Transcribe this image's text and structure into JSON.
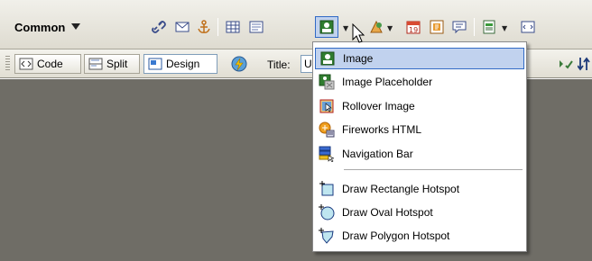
{
  "insert_bar": {
    "category": "Common",
    "tool_icons": [
      "hyperlink-icon",
      "email-link-icon",
      "named-anchor-icon",
      "table-icon",
      "div-icon",
      "image-icon",
      "media-icon",
      "date-icon",
      "server-side-include-icon",
      "comment-icon",
      "templates-icon",
      "tag-chooser-icon"
    ]
  },
  "doc_toolbar": {
    "code_label": "Code",
    "split_label": "Split",
    "design_label": "Design",
    "title_label": "Title:",
    "title_value": "U"
  },
  "image_menu": {
    "items": [
      {
        "label": "Image",
        "icon": "image-icon"
      },
      {
        "label": "Image Placeholder",
        "icon": "image-placeholder-icon"
      },
      {
        "label": "Rollover Image",
        "icon": "rollover-image-icon"
      },
      {
        "label": "Fireworks HTML",
        "icon": "fireworks-html-icon"
      },
      {
        "label": "Navigation Bar",
        "icon": "navigation-bar-icon"
      },
      {
        "label": "Draw Rectangle Hotspot",
        "icon": "rectangle-hotspot-icon"
      },
      {
        "label": "Draw Oval Hotspot",
        "icon": "oval-hotspot-icon"
      },
      {
        "label": "Draw Polygon Hotspot",
        "icon": "polygon-hotspot-icon"
      }
    ]
  },
  "colors": {
    "toolbar_bg": "#e6e3d9",
    "doc_area_bg": "#6f6d66",
    "menu_bg": "#ffffff",
    "selected_border": "#316ac5"
  }
}
